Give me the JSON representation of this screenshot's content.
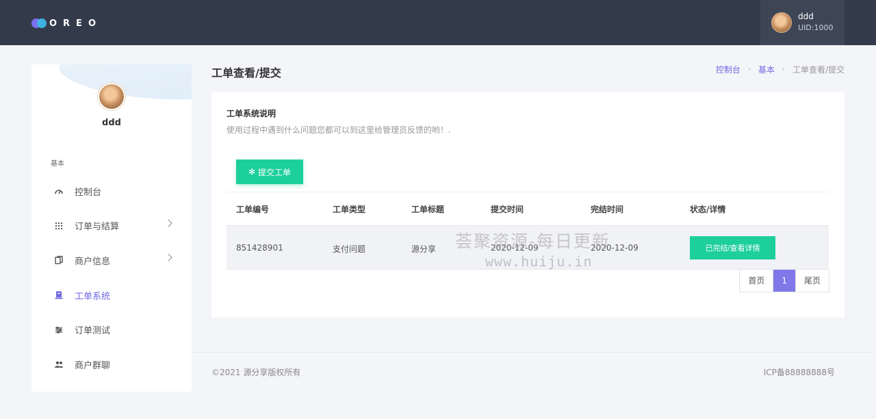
{
  "topbar": {
    "logo_text": "OREO",
    "user": {
      "name": "ddd",
      "uid": "UID:1000"
    }
  },
  "sidebar": {
    "profile_name": "ddd",
    "section_label": "基本",
    "items": [
      {
        "label": "控制台",
        "icon": "dashboard-icon",
        "has_arrow": false
      },
      {
        "label": "订单与结算",
        "icon": "grid-icon",
        "has_arrow": true
      },
      {
        "label": "商户信息",
        "icon": "copy-icon",
        "has_arrow": true
      },
      {
        "label": "工单系统",
        "icon": "ticket-icon",
        "has_arrow": false,
        "active": true
      },
      {
        "label": "订单测试",
        "icon": "sliders-icon",
        "has_arrow": false
      },
      {
        "label": "商户群聊",
        "icon": "users-icon",
        "has_arrow": false
      }
    ]
  },
  "page": {
    "title": "工单查看/提交",
    "breadcrumb": [
      "控制台",
      "基本",
      "工单查看/提交"
    ]
  },
  "card": {
    "title": "工单系统说明",
    "description": "使用过程中遇到什么问题您都可以到这里给管理员反馈的哟！.",
    "submit_label": "提交工单",
    "table": {
      "headers": [
        "工单编号",
        "工单类型",
        "工单标题",
        "提交时间",
        "完结时间",
        "状态/详情"
      ],
      "rows": [
        {
          "id": "851428901",
          "type": "支付问题",
          "title": "源分享",
          "submitted": "2020-12-09",
          "completed": "2020-12-09",
          "status": "已完结/查看详情"
        }
      ]
    },
    "pager": {
      "first": "首页",
      "current": "1",
      "last": "尾页"
    }
  },
  "watermark": {
    "line1": "荟聚资源-每日更新",
    "line2": "www.huiju.in"
  },
  "footer": {
    "copyright": "©2021 源分享版权所有",
    "icp": "ICP备88888888号"
  },
  "colors": {
    "topbar": "#333b4a",
    "accent": "#6f68e0",
    "success": "#1dcf9a"
  }
}
